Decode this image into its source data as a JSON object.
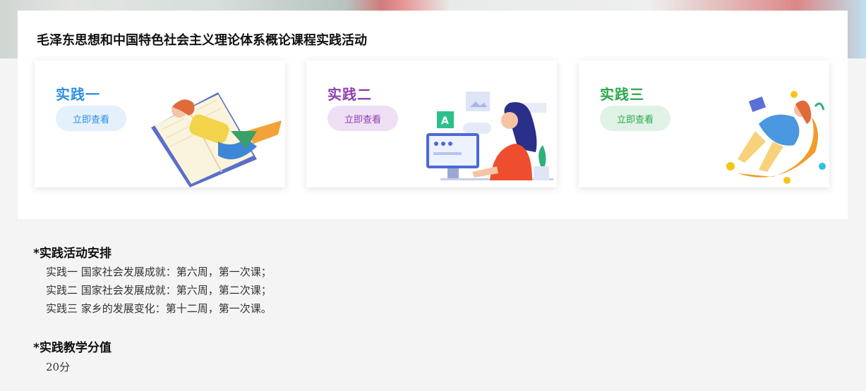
{
  "panel": {
    "title": "毛泽东思想和中国特色社会主义理论体系概论课程实践活动"
  },
  "cards": [
    {
      "title": "实践一",
      "button": "立即查看",
      "color": "#2e8fe0",
      "btn_bg": "#e4f0fc",
      "btn_color": "#2e8fe0"
    },
    {
      "title": "实践二",
      "button": "立即查看",
      "color": "#8e3fb0",
      "btn_bg": "#efdff5",
      "btn_color": "#8e3fb0"
    },
    {
      "title": "实践三",
      "button": "立即查看",
      "color": "#2aa84a",
      "btn_bg": "#dff2e5",
      "btn_color": "#2aa84a"
    }
  ],
  "schedule": {
    "title": "*实践活动安排",
    "lines": [
      "实践一 国家社会发展成就：第六周，第一次课；",
      "实践二 国家社会发展成就：第六周，第二次课；",
      "实践三 家乡的发展变化：第十二周，第一次课。"
    ]
  },
  "score": {
    "title": "*实践教学分值",
    "value": "20分"
  }
}
